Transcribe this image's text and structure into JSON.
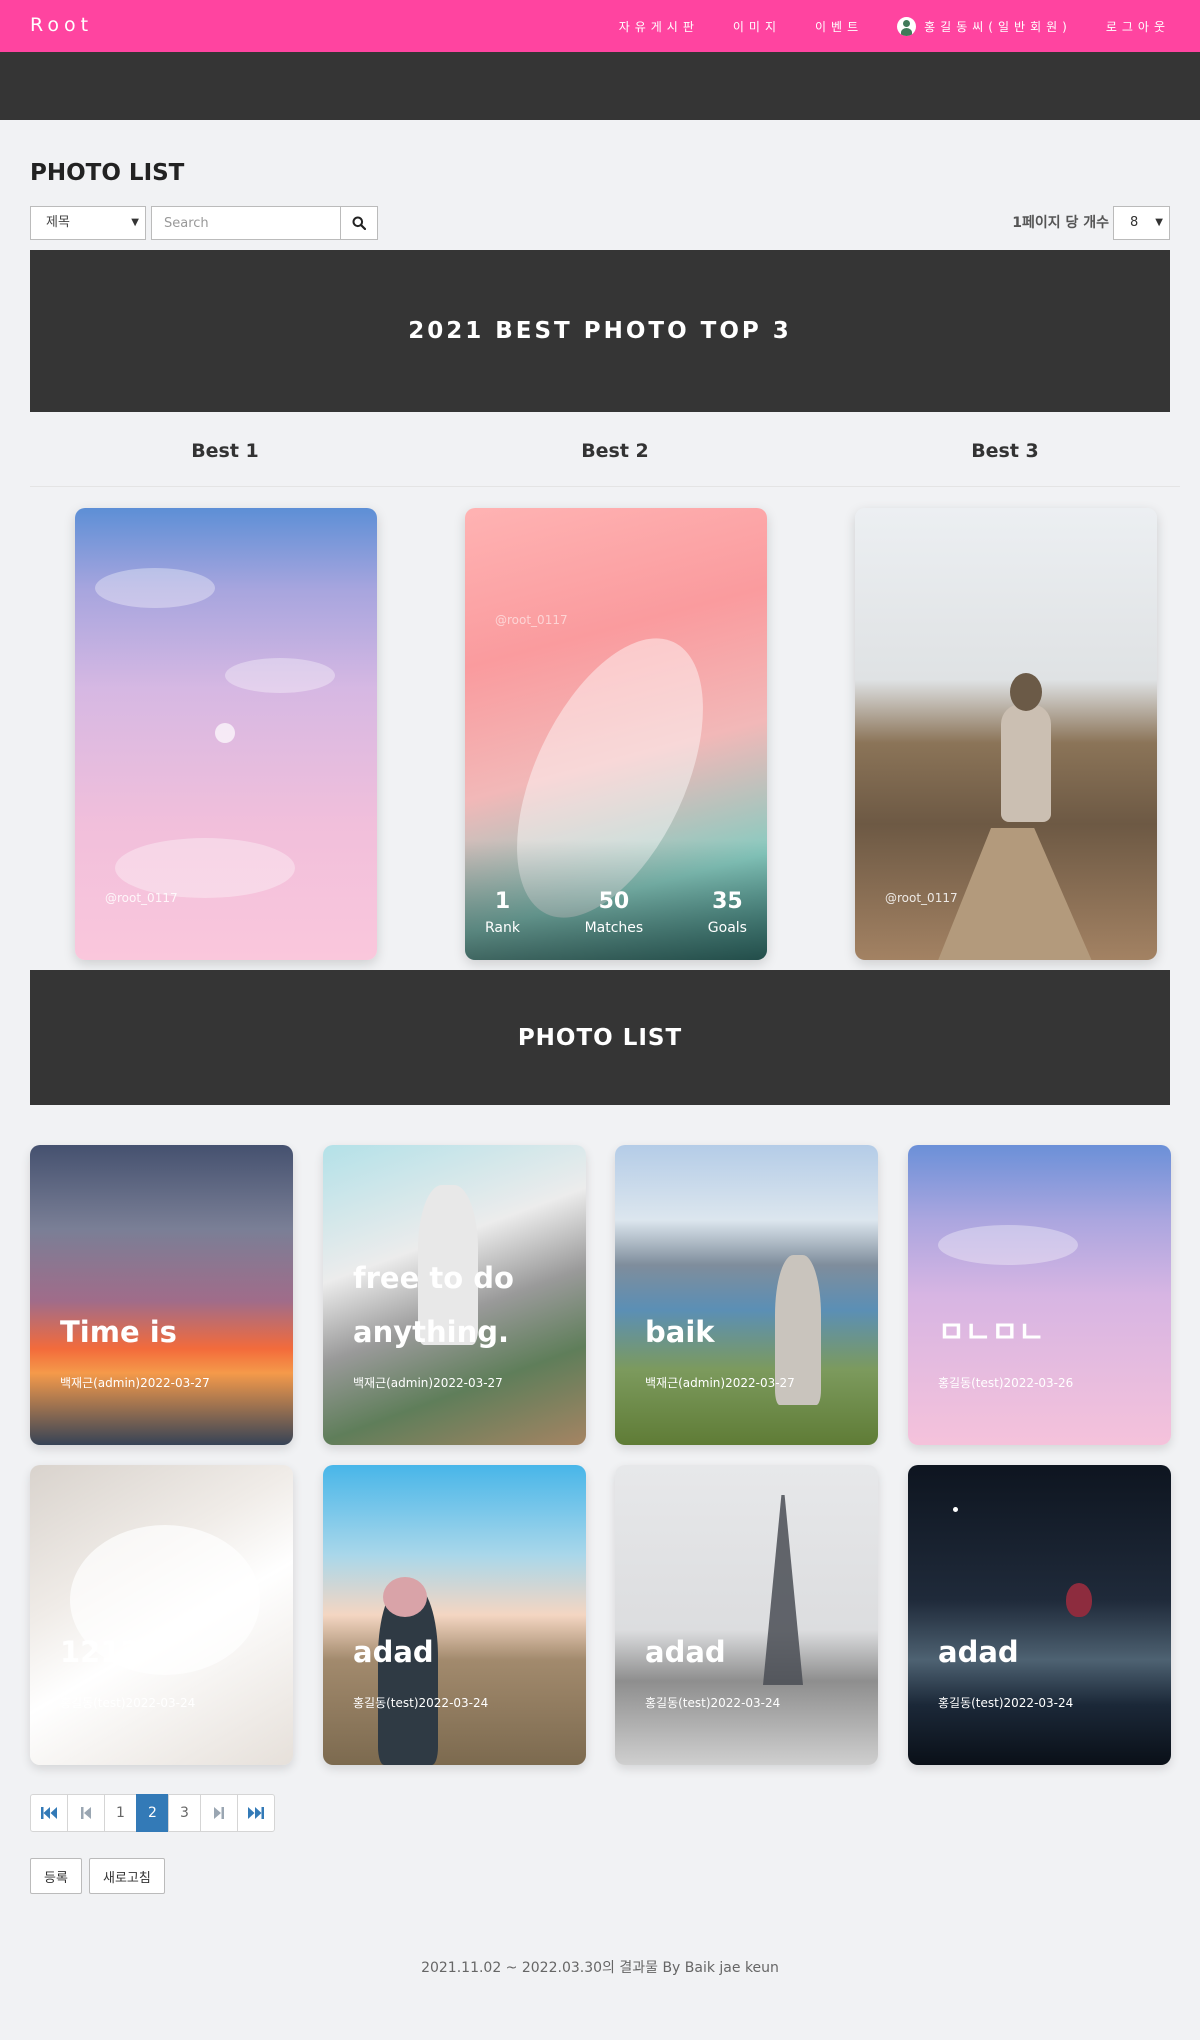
{
  "nav": {
    "brand": "Root",
    "links": [
      "자유게시판",
      "이미지",
      "이벤트"
    ],
    "user": "홍길동씨(일반회원)",
    "logout": "로그아웃"
  },
  "page": {
    "title": "PHOTO LIST",
    "search_field_value": "제목",
    "search_placeholder": "Search",
    "per_page_label": "1페이지 당 개수",
    "per_page_value": "8"
  },
  "best": {
    "banner": "2021 BEST PHOTO TOP 3",
    "items": [
      {
        "heading": "Best 1",
        "watermark": "@root_0117"
      },
      {
        "heading": "Best 2",
        "watermark": "@root_0117",
        "stats": [
          {
            "value": "1",
            "label": "Rank"
          },
          {
            "value": "50",
            "label": "Matches"
          },
          {
            "value": "35",
            "label": "Goals"
          }
        ]
      },
      {
        "heading": "Best 3",
        "watermark": "@root_0117"
      }
    ]
  },
  "list": {
    "banner": "PHOTO LIST",
    "photos": [
      {
        "title": "Time is",
        "meta": "백재근(admin)2022-03-27"
      },
      {
        "title": "free to do anything.",
        "meta": "백재근(admin)2022-03-27"
      },
      {
        "title": "baik",
        "meta": "백재근(admin)2022-03-27"
      },
      {
        "title": "ㅁㄴㅁㄴ",
        "meta": "홍길동(test)2022-03-26"
      },
      {
        "title": "1212",
        "meta": "홍길동(test)2022-03-24"
      },
      {
        "title": "adad",
        "meta": "홍길동(test)2022-03-24"
      },
      {
        "title": "adad",
        "meta": "홍길동(test)2022-03-24"
      },
      {
        "title": "adad",
        "meta": "홍길동(test)2022-03-24"
      }
    ]
  },
  "pagination": {
    "pages": [
      "1",
      "2",
      "3"
    ],
    "current": "2"
  },
  "actions": {
    "register": "등록",
    "refresh": "새로고침"
  },
  "footer": "2021.11.02 ~ 2022.03.30의 결과물 By Baik jae keun",
  "colors": {
    "nav_bg": "#ff44a0",
    "dark_bar": "#353535",
    "page_bg": "#f1f2f4",
    "pagination_active": "#337ab7"
  },
  "icons": {
    "search": "magnifier-icon",
    "first": "first-page-icon",
    "prev": "prev-page-icon",
    "next": "next-page-icon",
    "last": "last-page-icon"
  }
}
